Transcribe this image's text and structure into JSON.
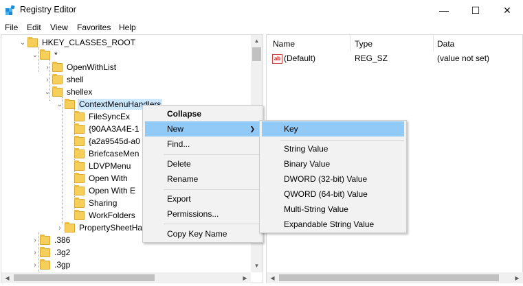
{
  "window": {
    "title": "Registry Editor",
    "minimize": "—",
    "maximize": "☐",
    "close": "✕"
  },
  "menubar": [
    "File",
    "Edit",
    "View",
    "Favorites",
    "Help"
  ],
  "tree": {
    "root": "HKEY_CLASSES_ROOT",
    "star": "*",
    "openwithlist": "OpenWithList",
    "shell": "shell",
    "shellex": "shellex",
    "cmh": "ContextMenuHandlers",
    "children": [
      "FileSyncEx",
      "{90AA3A4E-1",
      "{a2a9545d-a0",
      "BriefcaseMen",
      "LDVPMenu",
      "Open With",
      "Open With E",
      "Sharing",
      "WorkFolders"
    ],
    "propsheet": "PropertySheetHa",
    "ext1": ".386",
    "ext2": ".3g2",
    "ext3": ".3gp"
  },
  "list": {
    "headers": {
      "name": "Name",
      "type": "Type",
      "data": "Data"
    },
    "rows": [
      {
        "name": "(Default)",
        "type": "REG_SZ",
        "data": "(value not set)"
      }
    ]
  },
  "context_menu": {
    "collapse": "Collapse",
    "new": "New",
    "find": "Find...",
    "delete": "Delete",
    "rename": "Rename",
    "export": "Export",
    "permissions": "Permissions...",
    "copy_key_name": "Copy Key Name"
  },
  "new_submenu": {
    "key": "Key",
    "string": "String Value",
    "binary": "Binary Value",
    "dword": "DWORD (32-bit) Value",
    "qword": "QWORD (64-bit) Value",
    "multi": "Multi-String Value",
    "expandable": "Expandable String Value"
  },
  "colors": {
    "highlight": "#91c9f7",
    "selected": "#cce8ff",
    "folder": "#f5cf5a"
  }
}
